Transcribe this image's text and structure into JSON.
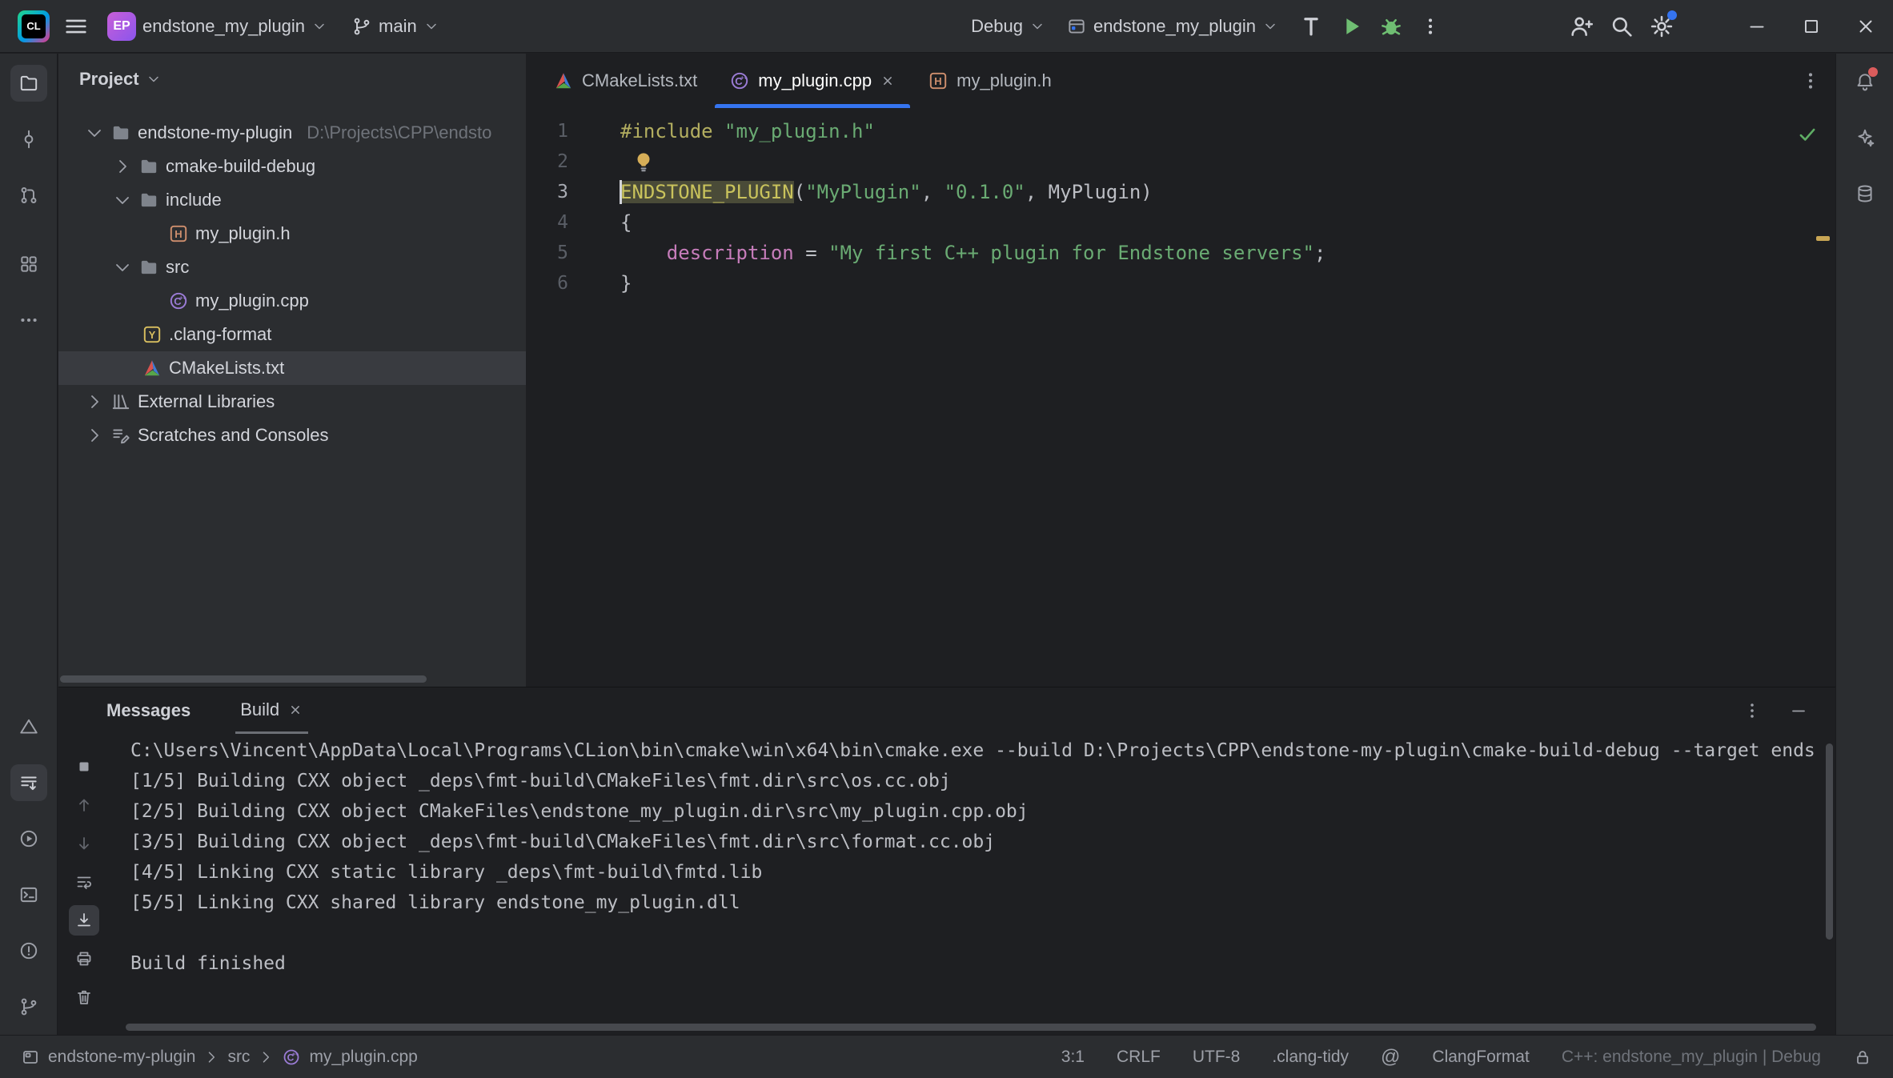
{
  "colors": {
    "accent": "#3574F0",
    "run_green": "#5FAD65",
    "error_red": "#DB5C5C",
    "string_green": "#6AAB73",
    "macro_olive": "#C9C35C",
    "field_purple": "#C77DBB",
    "directive_olive": "#B3AE60"
  },
  "titlebar": {
    "project_badge": "EP",
    "project_name": "endstone_my_plugin",
    "branch_name": "main",
    "config_mode": "Debug",
    "config_target": "endstone_my_plugin"
  },
  "project_panel": {
    "title": "Project",
    "items": [
      {
        "label": "endstone-my-plugin",
        "path": "D:\\Projects\\CPP\\endsto"
      },
      {
        "label": "cmake-build-debug"
      },
      {
        "label": "include"
      },
      {
        "label": "my_plugin.h"
      },
      {
        "label": "src"
      },
      {
        "label": "my_plugin.cpp"
      },
      {
        "label": ".clang-format"
      },
      {
        "label": "CMakeLists.txt"
      },
      {
        "label": "External Libraries"
      },
      {
        "label": "Scratches and Consoles"
      }
    ]
  },
  "editor": {
    "tabs": [
      {
        "label": "CMakeLists.txt"
      },
      {
        "label": "my_plugin.cpp"
      },
      {
        "label": "my_plugin.h"
      }
    ],
    "line_numbers": [
      "1",
      "2",
      "3",
      "4",
      "5",
      "6"
    ],
    "code": {
      "l1_directive": "#include",
      "l1_space": " ",
      "l1_string": "\"my_plugin.h\"",
      "l3_macro": "ENDSTONE_PLUGIN",
      "l3_open": "(",
      "l3_s1": "\"MyPlugin\"",
      "l3_sep1": ", ",
      "l3_s2": "\"0.1.0\"",
      "l3_sep2": ", ",
      "l3_arg": "MyPlugin",
      "l3_close": ")",
      "l4": "{",
      "l5_indent": "    ",
      "l5_field": "description",
      "l5_eq": " = ",
      "l5_string": "\"My first C++ plugin for Endstone servers\"",
      "l5_semi": ";",
      "l6": "}"
    }
  },
  "build_panel": {
    "title": "Messages",
    "tab_label": "Build",
    "lines": [
      "C:\\Users\\Vincent\\AppData\\Local\\Programs\\CLion\\bin\\cmake\\win\\x64\\bin\\cmake.exe --build D:\\Projects\\CPP\\endstone-my-plugin\\cmake-build-debug --target ends",
      "[1/5] Building CXX object _deps\\fmt-build\\CMakeFiles\\fmt.dir\\src\\os.cc.obj",
      "[2/5] Building CXX object CMakeFiles\\endstone_my_plugin.dir\\src\\my_plugin.cpp.obj",
      "[3/5] Building CXX object _deps\\fmt-build\\CMakeFiles\\fmt.dir\\src\\format.cc.obj",
      "[4/5] Linking CXX static library _deps\\fmt-build\\fmtd.lib",
      "[5/5] Linking CXX shared library endstone_my_plugin.dll",
      "",
      "Build finished"
    ]
  },
  "status_bar": {
    "breadcrumb": [
      "endstone-my-plugin",
      "src",
      "my_plugin.cpp"
    ],
    "caret_position": "3:1",
    "line_separator": "CRLF",
    "encoding": "UTF-8",
    "clang_tidy": ".clang-tidy",
    "clang_format": "ClangFormat",
    "resolve_context": "C++: endstone_my_plugin | Debug"
  }
}
